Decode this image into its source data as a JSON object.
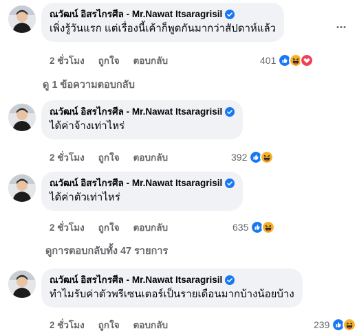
{
  "colors": {
    "bubble_bg": "#f0f2f5",
    "muted_text": "#65676b",
    "verified_blue": "#1877f2",
    "like_blue": "#1877f2",
    "haha_yellow": "#f7b125",
    "love_red": "#f33e58"
  },
  "more_menu": {
    "icon": "more-horizontal-icon",
    "glyph": "···"
  },
  "comments": [
    {
      "author": "ณวัฒน์ อิสรไกรศีล - Mr.Nawat Itsaragrisil",
      "text": "เพิ่งรู้วันแรก แต่เรื่องนี้เค้าก็พูดกันมากว่าสัปดาห์แล้ว",
      "time": "2 ชั่วโมง",
      "like_label": "ถูกใจ",
      "reply_label": "ตอบกลับ",
      "reaction_count": "401",
      "reactions": [
        "like",
        "haha",
        "love"
      ]
    },
    {
      "author": "ณวัฒน์ อิสรไกรศีล - Mr.Nawat Itsaragrisil",
      "text": "ได้ค่าจ้างเท่าไหร่",
      "time": "2 ชั่วโมง",
      "like_label": "ถูกใจ",
      "reply_label": "ตอบกลับ",
      "reaction_count": "392",
      "reactions": [
        "like",
        "haha"
      ]
    },
    {
      "author": "ณวัฒน์ อิสรไกรศีล - Mr.Nawat Itsaragrisil",
      "text": "ได้ค่าตัวเท่าไหร่",
      "time": "2 ชั่วโมง",
      "like_label": "ถูกใจ",
      "reply_label": "ตอบกลับ",
      "reaction_count": "635",
      "reactions": [
        "like",
        "haha"
      ]
    },
    {
      "author": "ณวัฒน์ อิสรไกรศีล - Mr.Nawat Itsaragrisil",
      "text": "ทำไมรับค่าตัวพรีเซนเตอร์เป็นรายเดือนมากบ้างน้อยบ้าง",
      "time": "2 ชั่วโมง",
      "like_label": "ถูกใจ",
      "reply_label": "ตอบกลับ",
      "reaction_count": "239",
      "reactions": [
        "like",
        "haha"
      ]
    }
  ],
  "view_reply_link": "ดู 1 ข้อความตอบกลับ",
  "view_all_replies_link": "ดูการตอบกลับทั้ง 47 รายการ"
}
